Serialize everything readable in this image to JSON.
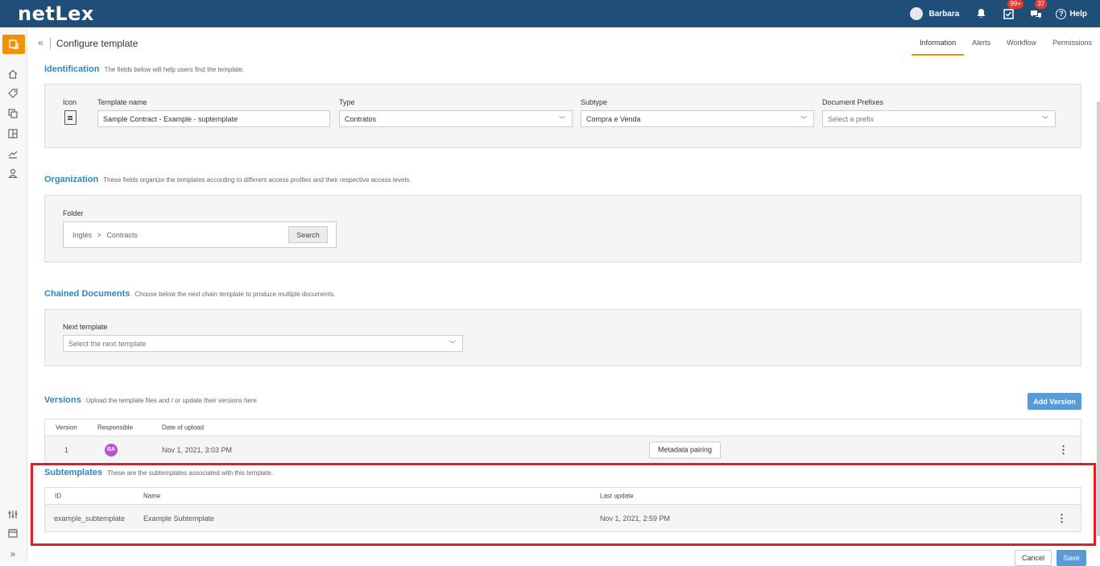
{
  "app": {
    "logo": "netLex"
  },
  "topbar": {
    "user_name": "Barbara",
    "tasks_badge": "99+",
    "chat_badge": "37",
    "help_label": "Help"
  },
  "header": {
    "collapse_glyph": "«",
    "title": "Configure template",
    "tabs": [
      {
        "label": "Information",
        "active": true
      },
      {
        "label": "Alerts"
      },
      {
        "label": "Workflow"
      },
      {
        "label": "Permissions"
      }
    ]
  },
  "identification": {
    "title": "Identification",
    "subtitle": "The fields below will help users find the template.",
    "icon_label": "Icon",
    "template_name_label": "Template name",
    "template_name_value": "Sample Contract - Example - suptemplate",
    "type_label": "Type",
    "type_value": "Contratos",
    "subtype_label": "Subtype",
    "subtype_value": "Compra e Venda",
    "prefix_label": "Document Prefixes",
    "prefix_placeholder": "Select a prefix"
  },
  "organization": {
    "title": "Organization",
    "subtitle": "These fields organize the templates according to different access profiles and their respective access levels.",
    "folder_label": "Folder",
    "folder_root": "Inglés",
    "folder_sep": ">",
    "folder_child": "Contracts",
    "search_label": "Search"
  },
  "chained": {
    "title": "Chained Documents",
    "subtitle": "Choose below the next chain template to produce multiple documents.",
    "next_label": "Next template",
    "next_placeholder": "Select the next template"
  },
  "versions": {
    "title": "Versions",
    "subtitle": "Upload the template files and / or update their versions here",
    "add_label": "Add Version",
    "columns": [
      "Version",
      "Responsible",
      "Date of upload"
    ],
    "rows": [
      {
        "version": "1",
        "responsible": "BA",
        "date": "Nov 1, 2021, 3:03 PM",
        "action": "Metadata pairing"
      }
    ]
  },
  "subtemplates": {
    "title": "Subtemplates",
    "subtitle": "These are the subtemplates associated with this template.",
    "columns": [
      "ID",
      "Name",
      "Last update"
    ],
    "rows": [
      {
        "id": "example_subtemplate",
        "name": "Example Subtemplate",
        "updated": "Nov 1, 2021, 2:59 PM"
      }
    ]
  },
  "footer": {
    "cancel_label": "Cancel",
    "save_label": "Save"
  },
  "colors": {
    "brand": "#1f4e79",
    "accent": "#f39200",
    "link": "#2e86c1",
    "highlight": "#e51c23"
  },
  "sidebar_icons": [
    "templates-icon",
    "home-icon",
    "tag-icon",
    "copy-icon",
    "board-icon",
    "chart-icon",
    "user-icon",
    "sliders-icon",
    "calendar-icon",
    "expand-icon"
  ]
}
